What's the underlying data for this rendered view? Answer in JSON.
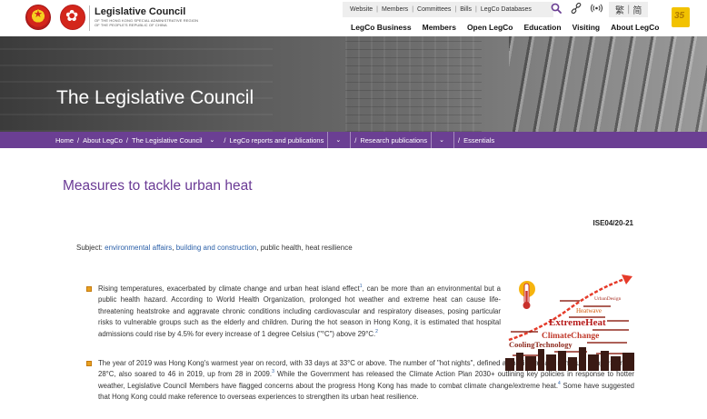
{
  "header": {
    "org_name": "Legislative Council",
    "org_sub_1": "OF THE HONG KONG SPECIAL ADMINISTRATIVE REGION",
    "org_sub_2": "OF THE PEOPLE'S REPUBLIC OF CHINA",
    "top_links": [
      "Website",
      "Members",
      "Committees",
      "Bills",
      "LegCo Databases"
    ],
    "lang_trad": "繁",
    "lang_simp": "简",
    "main_nav": [
      "LegCo Business",
      "Members",
      "Open LegCo",
      "Education",
      "Visiting",
      "About LegCo"
    ]
  },
  "banner": {
    "title": "The Legislative Council"
  },
  "breadcrumb": {
    "home": "Home",
    "about": "About LegCo",
    "council": "The Legislative Council",
    "reports": "LegCo reports and publications",
    "research": "Research publications",
    "essentials": "Essentials"
  },
  "article": {
    "title": "Measures to tackle urban heat",
    "doc_ref": "ISE04/20-21",
    "subject_label": "Subject:",
    "subject_link1": "environmental affairs",
    "subject_sep1": ",",
    "subject_link2": "building and construction",
    "subject_rest": ", public health, heat resilience",
    "p1_a": "Rising temperatures, exacerbated by climate change and urban heat island effect",
    "p1_fn1": "1",
    "p1_b": ", can be more than an environmental but a public health hazard. According to World Health Organization, prolonged hot weather and extreme heat can cause life-threatening heatstroke and aggravate chronic conditions including cardiovascular and respiratory diseases, posing particular risks to vulnerable groups such as the elderly and children. During the hot season in Hong Kong, it is estimated that hospital admissions could rise by 4.5% for every increase of 1 degree Celsius (\"°C\") above 29°C.",
    "p1_fn2": "2",
    "p2_a": "The year of 2019 was Hong Kong's warmest year on record, with 33 days at 33°C or above. The number of \"hot nights\", defined as having a daily minimum temperature of 28°C, also soared to 46 in 2019, up from 28 in 2009.",
    "p2_fn3": "3",
    "p2_b": "While the Government has released the Climate Action Plan 2030+ outlining key policies in response to hotter weather, Legislative Council Members have flagged concerns about the progress Hong Kong has made to combat climate change/extreme heat.",
    "p2_fn4": "4",
    "p2_c": " Some have suggested that Hong Kong could make reference to overseas experiences to strengthen its urban heat resilience."
  },
  "illustration": {
    "words": [
      "ExtremeHeat",
      "ClimateChange",
      "CoolingTechnology",
      "Heatwave",
      "UrbanDesign"
    ]
  },
  "colors": {
    "brand_purple": "#6b3f93",
    "title_purple": "#6a3a95",
    "link_blue": "#2a5fa8",
    "bullet_orange": "#e8a020"
  }
}
